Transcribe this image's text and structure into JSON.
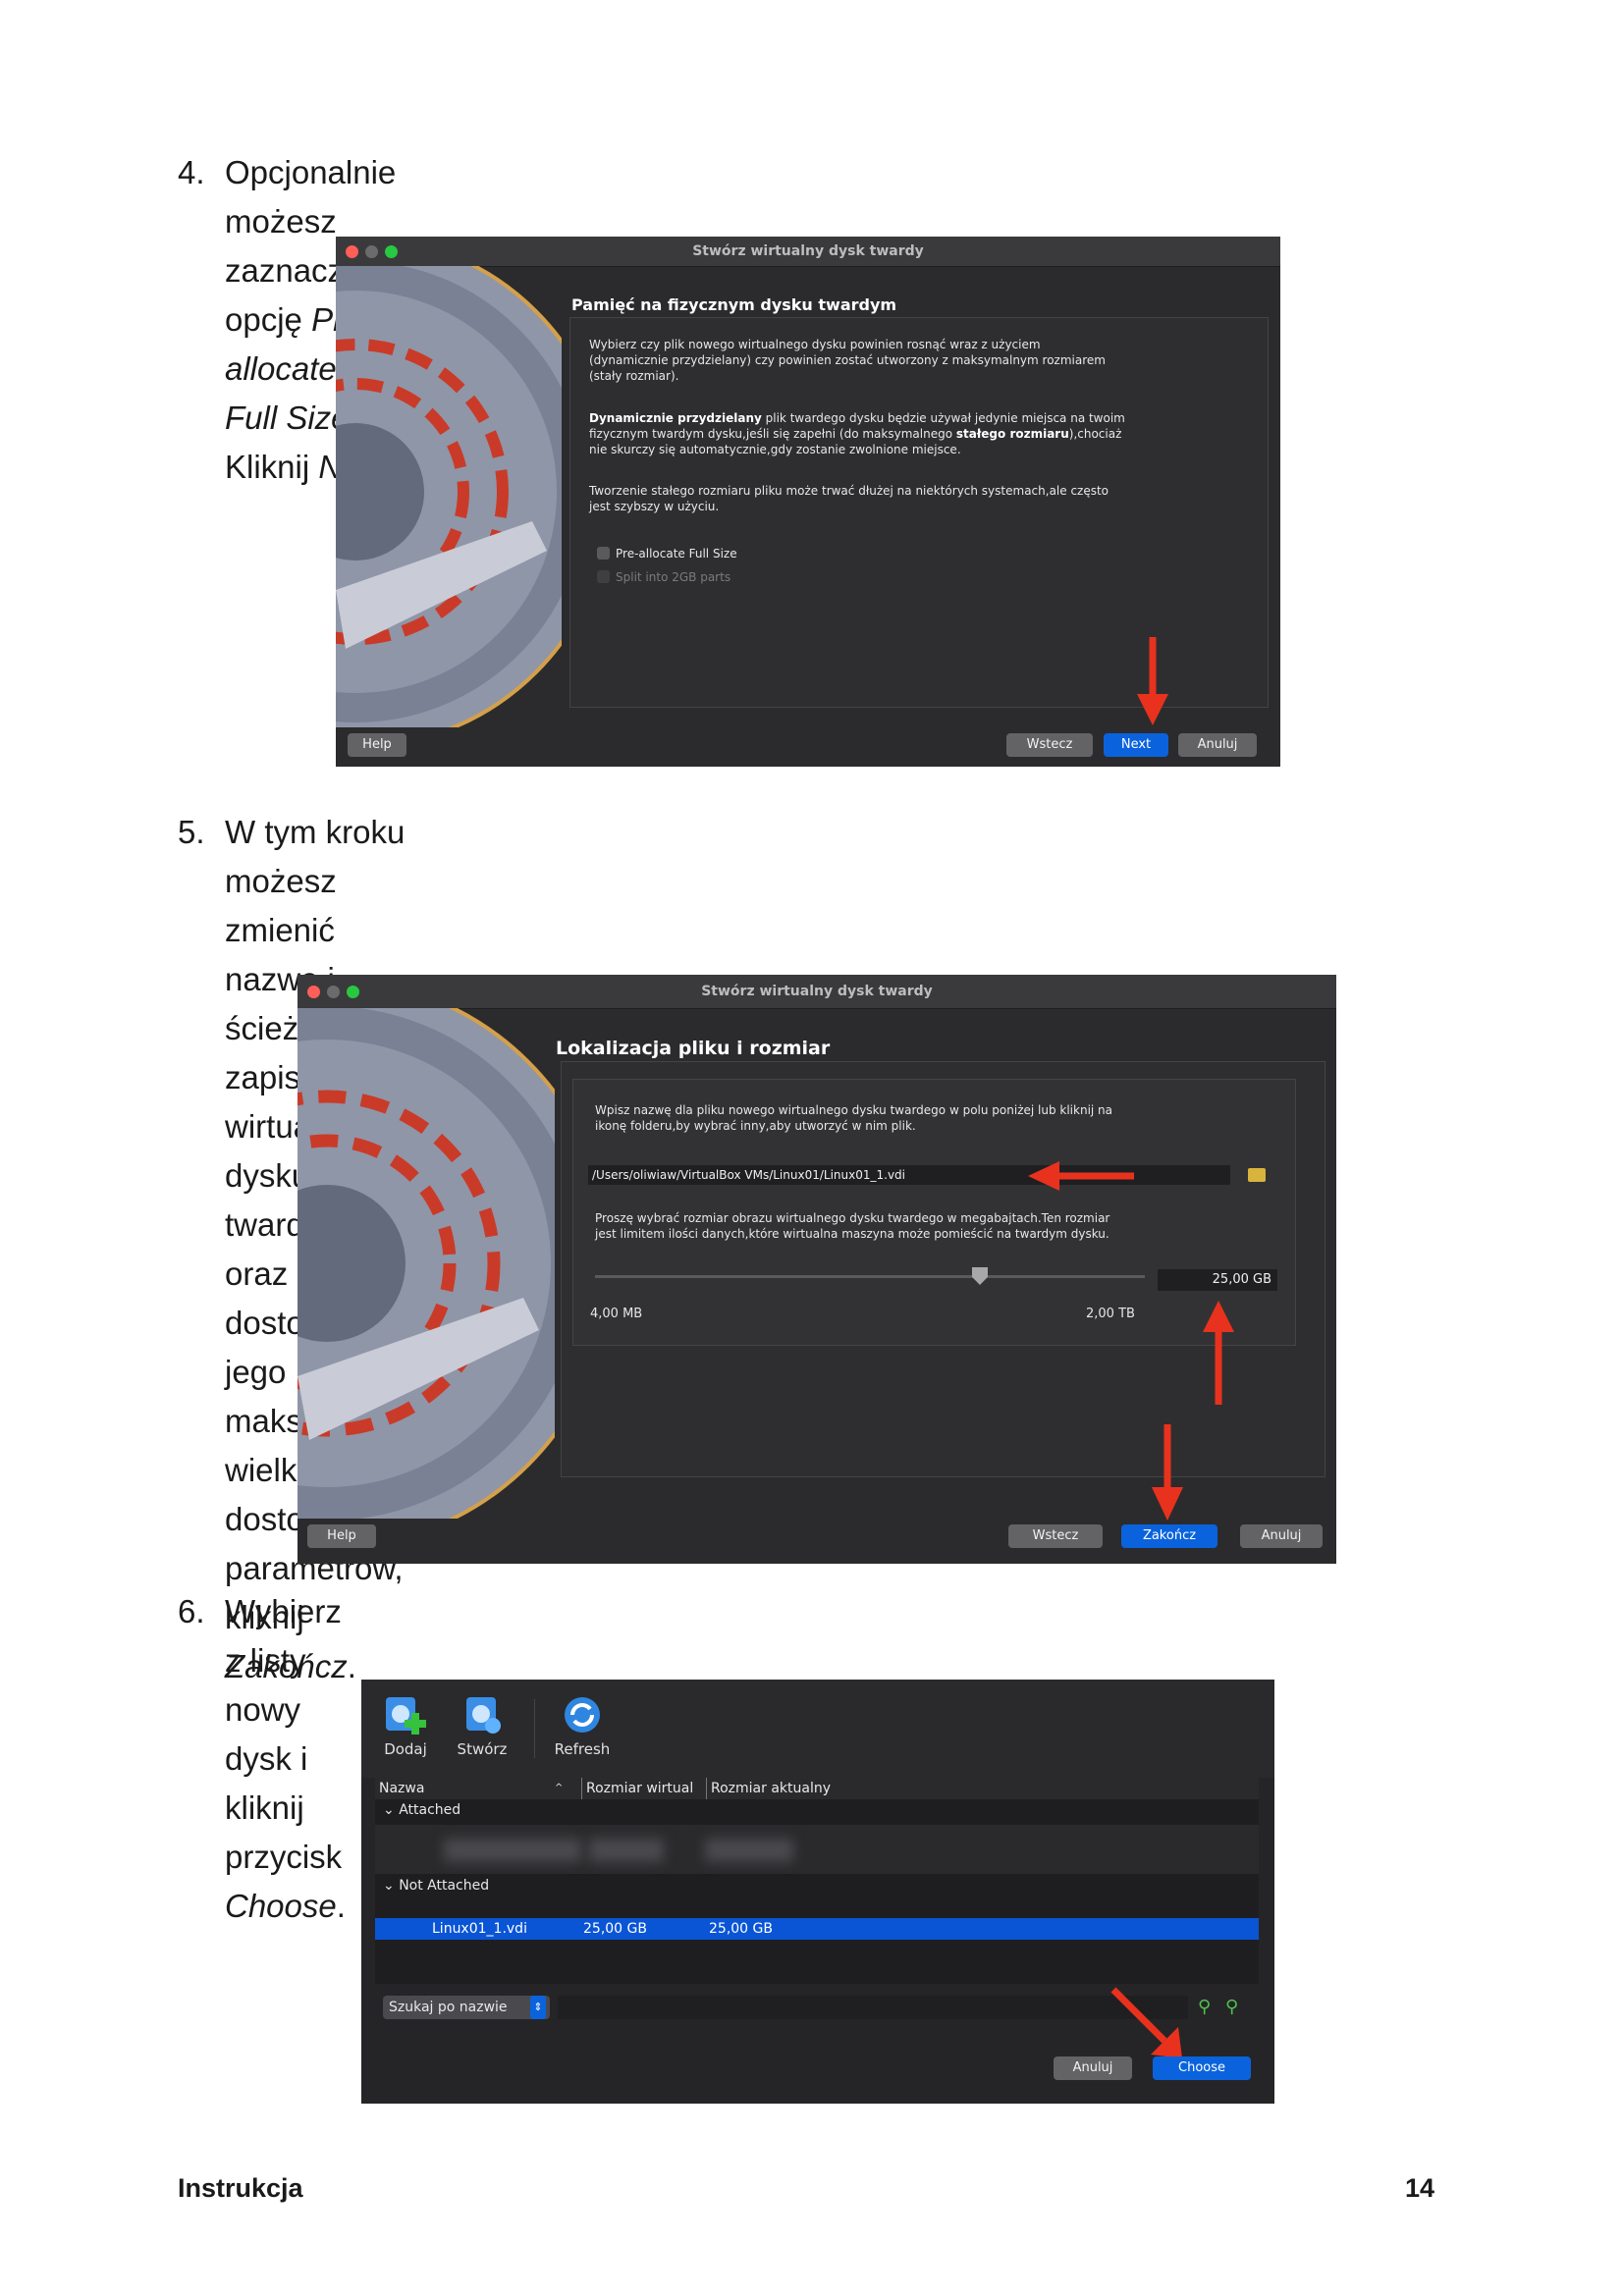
{
  "steps": [
    {
      "num": "4.",
      "parts": [
        {
          "t": "Opcjonalnie możesz zaznaczyć opcję "
        },
        {
          "t": "Pre-allocate Full Size",
          "i": true
        },
        {
          "t": ". Kliknij "
        },
        {
          "t": "Next",
          "i": true
        },
        {
          "t": "."
        }
      ]
    },
    {
      "num": "5.",
      "lines": [
        [
          {
            "t": "W tym kroku możesz zmienić nazwę i ścieżkę zapisu wirtualnego dysku"
          }
        ],
        [
          {
            "t": "twardego oraz dostosować jego maksymalną wielkość. Po dostosowaniu"
          }
        ],
        [
          {
            "t": "parametrów, kliknij "
          },
          {
            "t": "Zakończ",
            "i": true
          },
          {
            "t": "."
          }
        ]
      ]
    },
    {
      "num": "6.",
      "parts": [
        {
          "t": "Wybierz z listy nowy dysk i kliknij przycisk "
        },
        {
          "t": "Choose",
          "i": true
        },
        {
          "t": "."
        }
      ]
    }
  ],
  "shot1": {
    "window_title": "Stwórz wirtualny dysk twardy",
    "heading": "Pamięć na fizycznym dysku twardym",
    "p1": [
      "Wybierz czy plik nowego wirtualnego dysku powinien rosnąć wraz z użyciem",
      "(dynamicznie przydzielany) czy powinien zostać utworzony z maksymalnym rozmiarem",
      "(stały rozmiar)."
    ],
    "p2_bold": "Dynamicznie przydzielany",
    "p2a": " plik twardego dysku będzie używał jedynie miejsca na twoim",
    "p2b": "fizycznym twardym dysku,jeśli się zapełni (do maksymalnego ",
    "p2b_bold": "stałego rozmiaru",
    "p2b_end": "),chociaż",
    "p2c": "nie skurczy się automatycznie,gdy zostanie zwolnione miejsce.",
    "p3": [
      "Tworzenie stałego rozmiaru pliku może trwać dłużej na niektórych systemach,ale często",
      "jest szybszy w użyciu."
    ],
    "checkbox1": "Pre-allocate Full Size",
    "checkbox2": "Split into 2GB parts",
    "help": "Help",
    "back": "Wstecz",
    "next": "Next",
    "cancel": "Anuluj"
  },
  "shot2": {
    "window_title": "Stwórz wirtualny dysk twardy",
    "heading": "Lokalizacja pliku i rozmiar",
    "p1": [
      "Wpisz nazwę dla pliku nowego wirtualnego dysku twardego w polu poniżej lub kliknij na",
      "ikonę folderu,by wybrać inny,aby utworzyć w nim plik."
    ],
    "path": "/Users/oliwiaw/VirtualBox VMs/Linux01/Linux01_1.vdi",
    "p2": [
      "Proszę wybrać rozmiar obrazu wirtualnego dysku twardego w megabajtach.Ten rozmiar",
      "jest limitem ilości danych,które wirtualna maszyna może pomieścić na twardym dysku."
    ],
    "size": "25,00 GB",
    "min": "4,00 MB",
    "max": "2,00 TB",
    "slider_fraction": 0.7,
    "help": "Help",
    "back": "Wstecz",
    "finish": "Zakończ",
    "cancel": "Anuluj"
  },
  "shot3": {
    "toolbar": {
      "add": "Dodaj",
      "create": "Stwórz",
      "refresh": "Refresh"
    },
    "columns": {
      "name": "Nazwa",
      "virtual": "Rozmiar wirtual",
      "actual": "Rozmiar aktualny"
    },
    "group_attached": "Attached",
    "group_not_attached": "Not Attached",
    "row": {
      "name": "Linux01_1.vdi",
      "virtual": "25,00 GB",
      "actual": "25,00 GB"
    },
    "search": "Szukaj po nazwie",
    "cancel": "Anuluj",
    "choose": "Choose"
  },
  "footer": {
    "left": "Instrukcja",
    "right": "14"
  },
  "colors": {
    "arrow": "#e8321e",
    "primary_button": "#0a63dd",
    "selection": "#0a55d6",
    "window_bg": "#2b2b2d"
  }
}
